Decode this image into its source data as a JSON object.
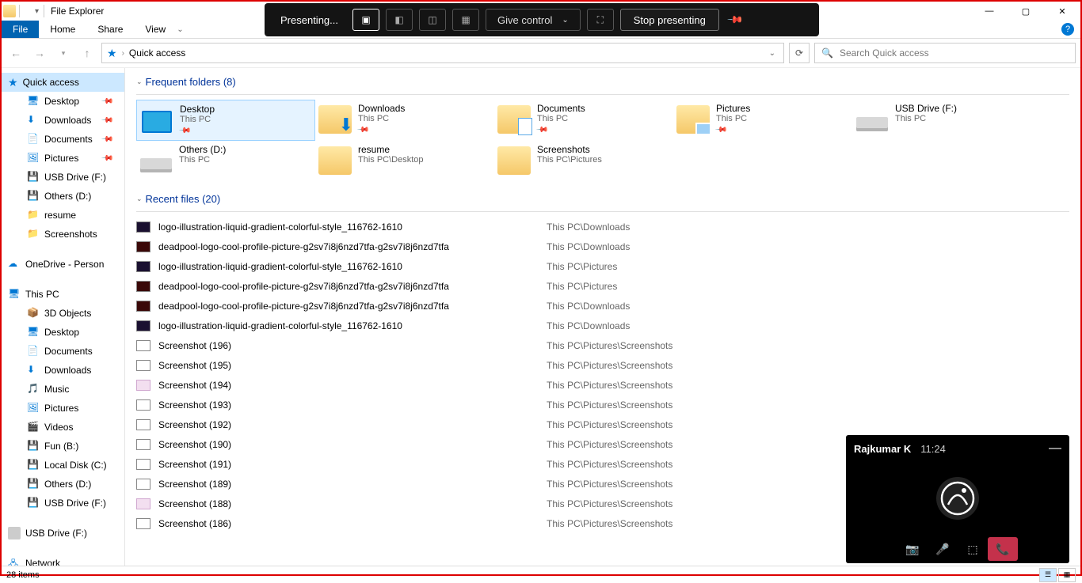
{
  "window": {
    "title": "File Explorer"
  },
  "ribbon": {
    "file": "File",
    "tabs": [
      "Home",
      "Share",
      "View"
    ]
  },
  "address": {
    "location": "Quick access"
  },
  "search": {
    "placeholder": "Search Quick access"
  },
  "sidebar": {
    "quick_access": "Quick access",
    "qa_items": [
      {
        "label": "Desktop",
        "pinned": true
      },
      {
        "label": "Downloads",
        "pinned": true
      },
      {
        "label": "Documents",
        "pinned": true
      },
      {
        "label": "Pictures",
        "pinned": true
      },
      {
        "label": "USB Drive (F:)",
        "pinned": false
      },
      {
        "label": "Others (D:)",
        "pinned": false
      },
      {
        "label": "resume",
        "pinned": false
      },
      {
        "label": "Screenshots",
        "pinned": false
      }
    ],
    "onedrive": "OneDrive - Person",
    "this_pc": "This PC",
    "pc_items": [
      "3D Objects",
      "Desktop",
      "Documents",
      "Downloads",
      "Music",
      "Pictures",
      "Videos",
      "Fun (B:)",
      "Local Disk (C:)",
      "Others (D:)",
      "USB Drive (F:)"
    ],
    "usb": "USB Drive (F:)",
    "network": "Network"
  },
  "sections": {
    "freq_title": "Frequent folders (8)",
    "recent_title": "Recent files (20)"
  },
  "folders": [
    {
      "name": "Desktop",
      "sub": "This PC",
      "pin": true,
      "icon": "desktop",
      "selected": true
    },
    {
      "name": "Downloads",
      "sub": "This PC",
      "pin": true,
      "icon": "downloads"
    },
    {
      "name": "Documents",
      "sub": "This PC",
      "pin": true,
      "icon": "documents"
    },
    {
      "name": "Pictures",
      "sub": "This PC",
      "pin": true,
      "icon": "pictures"
    },
    {
      "name": "USB Drive (F:)",
      "sub": "This PC",
      "pin": false,
      "icon": "drive"
    },
    {
      "name": "Others (D:)",
      "sub": "This PC",
      "pin": false,
      "icon": "drive"
    },
    {
      "name": "resume",
      "sub": "This PC\\Desktop",
      "pin": false,
      "icon": "folder"
    },
    {
      "name": "Screenshots",
      "sub": "This PC\\Pictures",
      "pin": false,
      "icon": "folder"
    }
  ],
  "files": [
    {
      "name": "logo-illustration-liquid-gradient-colorful-style_116762-1610",
      "loc": "This PC\\Downloads",
      "thumb": "dark"
    },
    {
      "name": "deadpool-logo-cool-profile-picture-g2sv7i8j6nzd7tfa-g2sv7i8j6nzd7tfa",
      "loc": "This PC\\Downloads",
      "thumb": "red"
    },
    {
      "name": "logo-illustration-liquid-gradient-colorful-style_116762-1610",
      "loc": "This PC\\Pictures",
      "thumb": "dark"
    },
    {
      "name": "deadpool-logo-cool-profile-picture-g2sv7i8j6nzd7tfa-g2sv7i8j6nzd7tfa",
      "loc": "This PC\\Pictures",
      "thumb": "red"
    },
    {
      "name": "deadpool-logo-cool-profile-picture-g2sv7i8j6nzd7tfa-g2sv7i8j6nzd7tfa",
      "loc": "This PC\\Downloads",
      "thumb": "red"
    },
    {
      "name": "logo-illustration-liquid-gradient-colorful-style_116762-1610",
      "loc": "This PC\\Downloads",
      "thumb": "dark"
    },
    {
      "name": "Screenshot (196)",
      "loc": "This PC\\Pictures\\Screenshots",
      "thumb": "white"
    },
    {
      "name": "Screenshot (195)",
      "loc": "This PC\\Pictures\\Screenshots",
      "thumb": "white"
    },
    {
      "name": "Screenshot (194)",
      "loc": "This PC\\Pictures\\Screenshots",
      "thumb": "pink"
    },
    {
      "name": "Screenshot (193)",
      "loc": "This PC\\Pictures\\Screenshots",
      "thumb": "white"
    },
    {
      "name": "Screenshot (192)",
      "loc": "This PC\\Pictures\\Screenshots",
      "thumb": "white"
    },
    {
      "name": "Screenshot (190)",
      "loc": "This PC\\Pictures\\Screenshots",
      "thumb": "white"
    },
    {
      "name": "Screenshot (191)",
      "loc": "This PC\\Pictures\\Screenshots",
      "thumb": "white"
    },
    {
      "name": "Screenshot (189)",
      "loc": "This PC\\Pictures\\Screenshots",
      "thumb": "white"
    },
    {
      "name": "Screenshot (188)",
      "loc": "This PC\\Pictures\\Screenshots",
      "thumb": "pink"
    },
    {
      "name": "Screenshot (186)",
      "loc": "This PC\\Pictures\\Screenshots",
      "thumb": "white"
    }
  ],
  "status": {
    "count": "28 items"
  },
  "teams_bar": {
    "presenting": "Presenting...",
    "give_control": "Give control",
    "stop": "Stop presenting"
  },
  "call": {
    "name": "Rajkumar K",
    "time": "11:24"
  }
}
